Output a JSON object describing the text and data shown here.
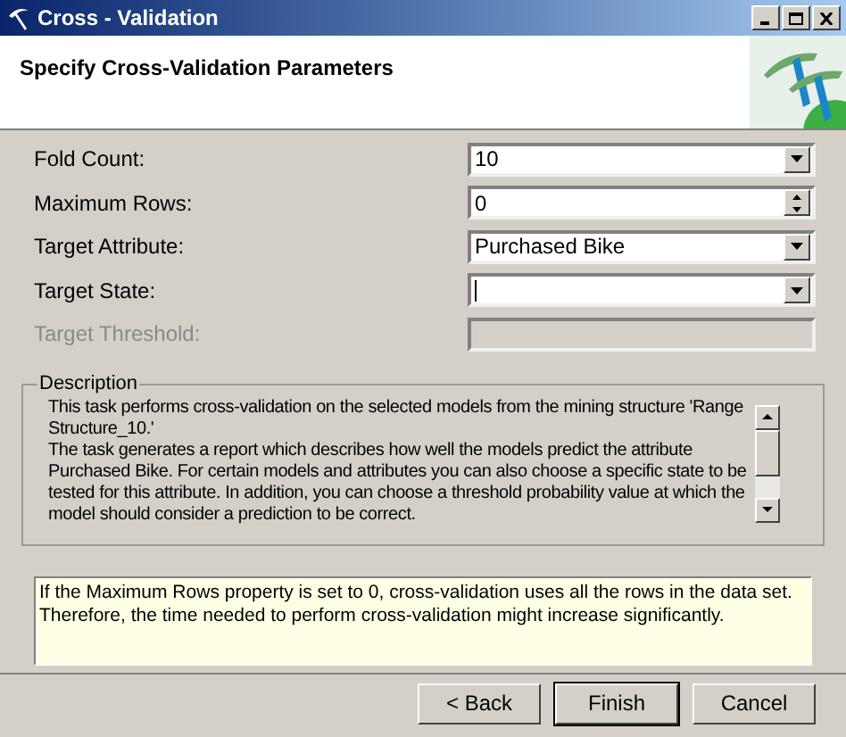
{
  "window": {
    "title": "Cross - Validation"
  },
  "header": {
    "title": "Specify Cross-Validation Parameters"
  },
  "fields": [
    {
      "label": "Fold Count:",
      "kind": "dropdown",
      "value": "10",
      "disabled": false
    },
    {
      "label": "Maximum Rows:",
      "kind": "spinner",
      "value": "0",
      "disabled": false
    },
    {
      "label": "Target Attribute:",
      "kind": "dropdown",
      "value": "Purchased Bike",
      "disabled": false
    },
    {
      "label": "Target State:",
      "kind": "dropdown",
      "disabled": false
    },
    {
      "label": "Target Threshold:",
      "kind": "textbox",
      "disabled": true
    }
  ],
  "description": {
    "title": "Description",
    "paragraphs": [
      "This task performs cross-validation on the selected models from the mining structure 'Range Structure_10.'",
      "The task generates a report which describes how well the models predict the attribute Purchased Bike.  For certain models and attributes you can also choose a specific state to be tested for this attribute. In addition, you can choose a threshold probability value at which the model should consider a prediction to be correct."
    ]
  },
  "note": "If the Maximum Rows property is set to 0, cross-validation uses all the rows in the data set. Therefore, the time needed to perform cross-validation might increase significantly.",
  "buttons": [
    {
      "label": "< Back",
      "default": false
    },
    {
      "label": "Finish",
      "default": true
    },
    {
      "label": "Cancel",
      "default": false
    }
  ]
}
